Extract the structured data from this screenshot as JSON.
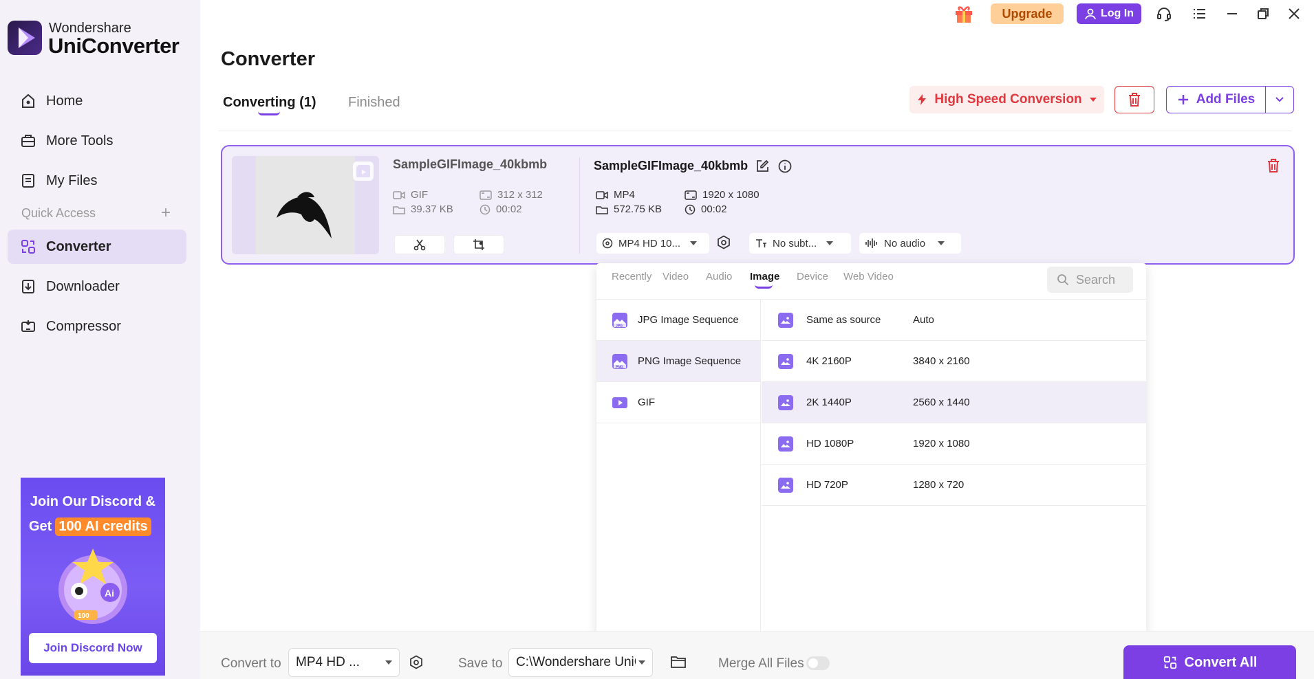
{
  "app": {
    "brand": "Wondershare",
    "product": "UniConverter"
  },
  "topbar": {
    "upgrade_label": "Upgrade",
    "login_label": "Log In"
  },
  "sidebar": {
    "items": [
      {
        "label": "Home",
        "icon": "home-icon"
      },
      {
        "label": "More Tools",
        "icon": "toolbox-icon"
      },
      {
        "label": "My Files",
        "icon": "files-icon"
      }
    ],
    "quick_access_label": "Quick Access",
    "quick_items": [
      {
        "label": "Converter",
        "icon": "converter-icon",
        "active": true
      },
      {
        "label": "Downloader",
        "icon": "downloader-icon"
      },
      {
        "label": "Compressor",
        "icon": "compressor-icon"
      }
    ]
  },
  "promo": {
    "line1": "Join Our Discord &",
    "line2_prefix": "Get",
    "line2_highlight": "100 AI credits",
    "button_label": "Join Discord Now",
    "badge_ai": "Ai",
    "badge_100": "100"
  },
  "main": {
    "title": "Converter",
    "tabs": [
      {
        "label": "Converting (1)",
        "active": true
      },
      {
        "label": "Finished",
        "active": false
      }
    ],
    "high_speed_label": "High Speed Conversion",
    "add_files_label": "Add Files"
  },
  "file": {
    "source": {
      "name": "SampleGIFImage_40kbmb",
      "format": "GIF",
      "resolution": "312 x 312",
      "size": "39.37 KB",
      "duration": "00:02"
    },
    "output": {
      "name": "SampleGIFImage_40kbmb",
      "format": "MP4",
      "resolution": "1920 x 1080",
      "size": "572.75 KB",
      "duration": "00:02"
    },
    "format_select": "MP4 HD 10...",
    "subtitle_select": "No subt...",
    "audio_select": "No audio"
  },
  "format_dropdown": {
    "tabs": [
      "Recently",
      "Video",
      "Audio",
      "Image",
      "Device",
      "Web Video"
    ],
    "active_tab": "Image",
    "search_placeholder": "Search",
    "categories": [
      {
        "label": "JPG Image Sequence",
        "badge": "JPG"
      },
      {
        "label": "PNG Image Sequence",
        "badge": "PNG",
        "active": true
      },
      {
        "label": "GIF",
        "badge": ""
      }
    ],
    "resolutions": [
      {
        "name": "Same as source",
        "size": "Auto"
      },
      {
        "name": "4K 2160P",
        "size": "3840 x 2160"
      },
      {
        "name": "2K 1440P",
        "size": "2560 x 1440",
        "active": true
      },
      {
        "name": "HD 1080P",
        "size": "1920 x 1080"
      },
      {
        "name": "HD 720P",
        "size": "1280 x 720"
      }
    ]
  },
  "bottombar": {
    "convert_to_label": "Convert to",
    "convert_to_value": "MP4 HD ...",
    "save_to_label": "Save to",
    "save_to_value": "C:\\Wondershare UniCo",
    "merge_label": "Merge All Files",
    "merge_enabled": false,
    "convert_all_label": "Convert All"
  },
  "colors": {
    "accent": "#7b3fe4",
    "danger": "#e0383e",
    "upgrade_bg": "#ffcf9a"
  }
}
